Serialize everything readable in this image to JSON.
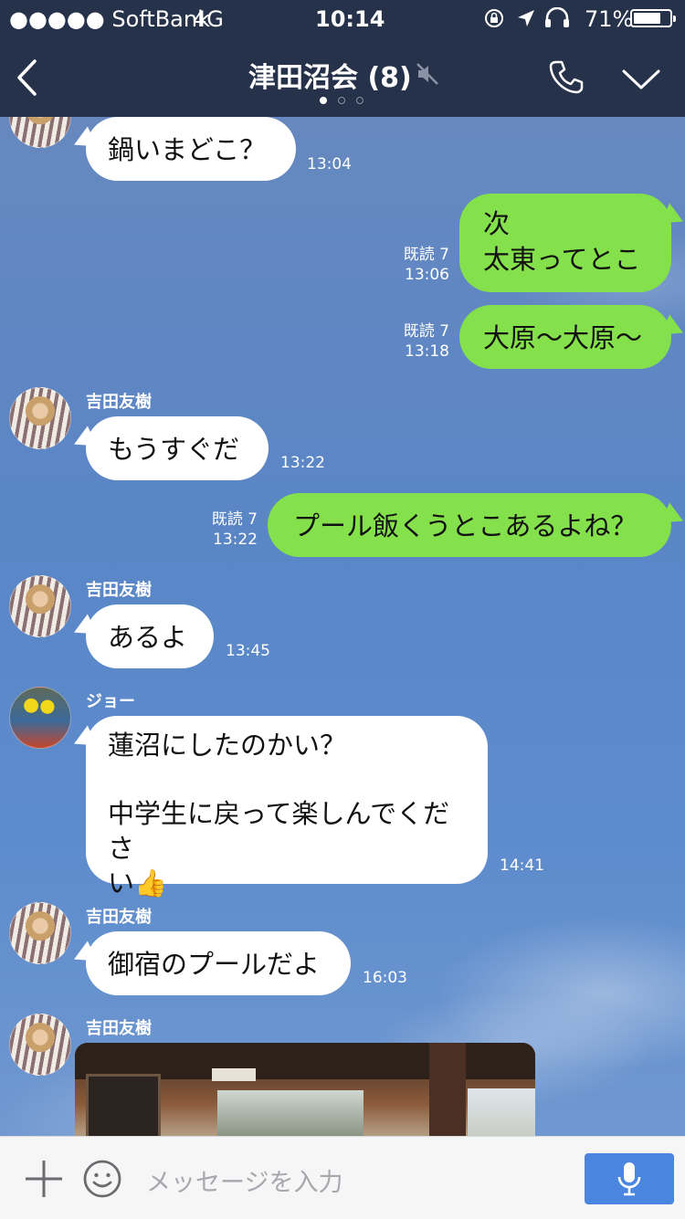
{
  "status_bar": {
    "carrier": "●●●●● SoftBank",
    "network": "4G",
    "time": "10:14",
    "battery": "71%"
  },
  "header": {
    "title": "津田沼会 (8)",
    "back_icon": "chevron-left-icon",
    "mute_icon": "speaker-muted-icon",
    "call_icon": "phone-icon",
    "menu_icon": "chevron-down-icon"
  },
  "messages": [
    {
      "type": "in",
      "text": "鍋いまどこ？",
      "time": "13:04"
    },
    {
      "type": "out",
      "text": "次\n太東ってとこ",
      "read": "既読 7",
      "time": "13:06"
    },
    {
      "type": "out",
      "text": "大原〜大原〜",
      "read": "既読 7",
      "time": "13:18"
    },
    {
      "type": "in",
      "sender": "吉田友樹",
      "text": "もうすぐだ",
      "time": "13:22"
    },
    {
      "type": "out",
      "text": "プール飯くうとこあるよね？",
      "read": "既読 7",
      "time": "13:22"
    },
    {
      "type": "in",
      "sender": "吉田友樹",
      "text": "あるよ",
      "time": "13:45"
    },
    {
      "type": "in",
      "sender": "ジョー",
      "text": "蓮沼にしたのかい？\n\n中学生に戻って楽しんでくださ\nい👍",
      "time": "14:41"
    },
    {
      "type": "in",
      "sender": "吉田友樹",
      "text": "御宿のプールだよ",
      "time": "16:03"
    },
    {
      "type": "image",
      "sender": "吉田友樹"
    }
  ],
  "input_bar": {
    "placeholder": "メッセージを入力",
    "plus_icon": "plus-icon",
    "emoji_icon": "smiley-icon",
    "mic_icon": "microphone-icon"
  },
  "colors": {
    "header_bg": "#26324a",
    "outgoing_bubble": "#84e04b",
    "incoming_bubble": "#ffffff",
    "chat_bg": "#5b86c2",
    "mic_button": "#4a86e0"
  }
}
